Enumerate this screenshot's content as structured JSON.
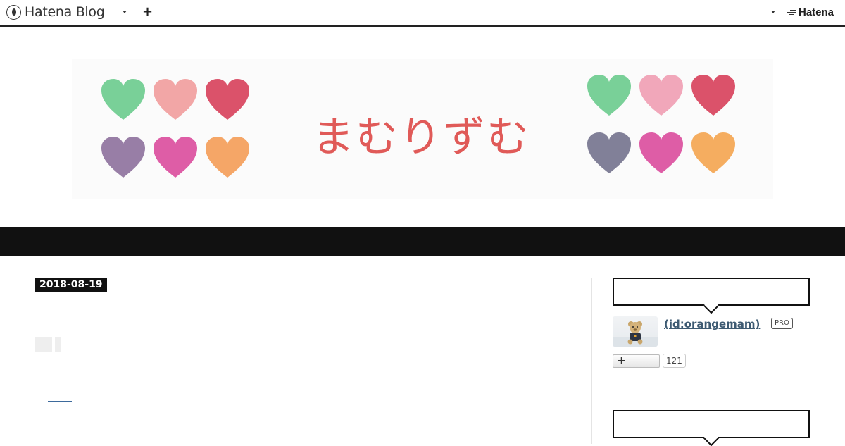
{
  "topbar": {
    "brand_name": "Hatena Blog",
    "plus_label": "+",
    "hatena_label": "Hatena"
  },
  "header": {
    "blog_title": "まむりずむ",
    "heart_colors": {
      "left": [
        "#67c98a",
        "#f09a9a",
        "#d63a55",
        "#8a6c9a",
        "#d9479a",
        "#f49a52"
      ],
      "right": [
        "#67c98a",
        "#ef9bb0",
        "#d63a55",
        "#6f6e8a",
        "#d9479a",
        "#f4a24a"
      ]
    }
  },
  "article": {
    "date": "2018-08-19"
  },
  "sidebar": {
    "profile": {
      "username": "(id:orangemam)",
      "pro_badge": "PRO",
      "follow_plus": "+",
      "reader_count": "121"
    }
  },
  "colors": {
    "accent_title": "#e05a58",
    "nav_bg": "#111111",
    "link": "#3d5a72"
  }
}
